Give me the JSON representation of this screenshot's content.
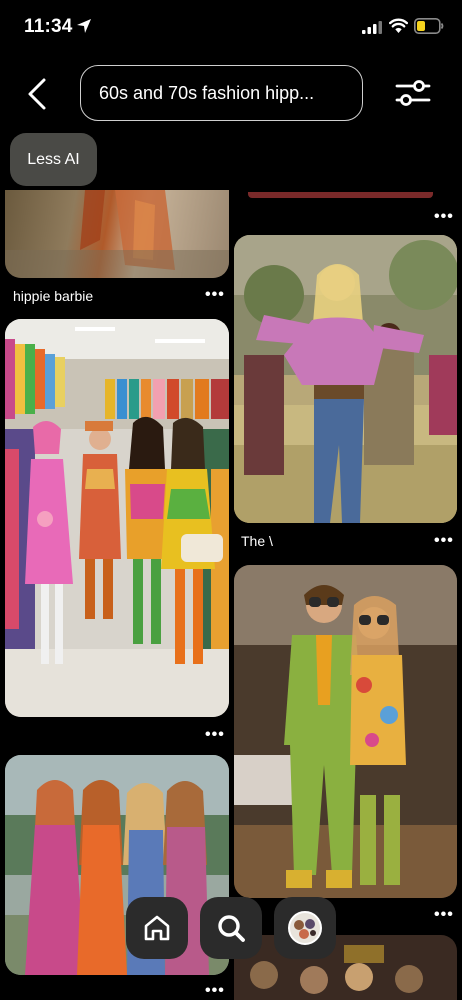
{
  "status": {
    "time": "11:34"
  },
  "search": {
    "query": "60s and 70s fashion hipp..."
  },
  "chips": {
    "less_ai": "Less AI"
  },
  "pins": {
    "left_top_label": "hippie barbie",
    "right_top_label": "The \\"
  },
  "icons": {
    "back": "back-chevron-icon",
    "filter": "filter-sliders-icon",
    "more": "more-dots-icon",
    "home": "home-icon",
    "search": "search-icon",
    "profile": "profile-avatar-icon"
  },
  "colors": {
    "background": "#000000",
    "chip": "#4a4a46",
    "nav_pill": "#2b2b2b",
    "battery": "#f5d31e"
  }
}
